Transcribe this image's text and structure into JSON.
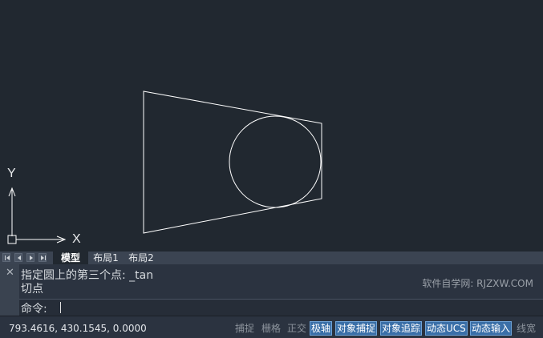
{
  "viewport": {
    "axis_y_label": "Y",
    "axis_x_label": "X"
  },
  "tabs": {
    "model": "模型",
    "layout1": "布局1",
    "layout2": "布局2"
  },
  "command_line": {
    "history": [
      "指定圆上的第三个点: _tan",
      "切点"
    ],
    "prompt": "命令:",
    "close_glyph": "✕",
    "watermark": "软件自学网: RJZXW.COM"
  },
  "status_bar": {
    "coordinates": "793.4616, 430.1545, 0.0000",
    "toggles": [
      {
        "label": "捕捉",
        "active": false
      },
      {
        "label": "栅格",
        "active": false
      },
      {
        "label": "正交",
        "active": false
      },
      {
        "label": "极轴",
        "active": true
      },
      {
        "label": "对象捕捉",
        "active": true
      },
      {
        "label": "对象追踪",
        "active": true
      },
      {
        "label": "动态UCS",
        "active": true
      },
      {
        "label": "动态输入",
        "active": true
      },
      {
        "label": "线宽",
        "active": false
      }
    ]
  },
  "colors": {
    "canvas_background": "#212830",
    "active_toggle": "#3a6fa8"
  }
}
